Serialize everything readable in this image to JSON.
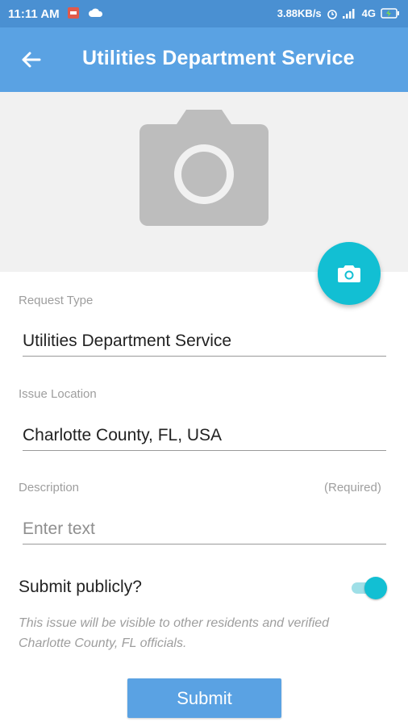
{
  "status_bar": {
    "time": "11:11 AM",
    "network_speed": "3.88KB/s",
    "network_type": "4G"
  },
  "app_bar": {
    "title": "Utilities Department Service"
  },
  "form": {
    "request_type": {
      "label": "Request Type",
      "value": "Utilities Department Service"
    },
    "issue_location": {
      "label": "Issue Location",
      "value": "Charlotte County, FL, USA"
    },
    "description": {
      "label": "Description",
      "required": "(Required)",
      "placeholder": "Enter text"
    },
    "submit_publicly": {
      "label": "Submit publicly?",
      "enabled": true,
      "note": "This issue will be visible to other residents and verified Charlotte County, FL officials."
    },
    "submit_label": "Submit"
  },
  "colors": {
    "app_bar": "#5aa2e3",
    "accent": "#12bfd3",
    "photo_placeholder_bg": "#f1f1f1"
  },
  "icons": {
    "back": "arrow-left-icon",
    "placeholder": "camera-icon",
    "fab": "camera-icon"
  }
}
